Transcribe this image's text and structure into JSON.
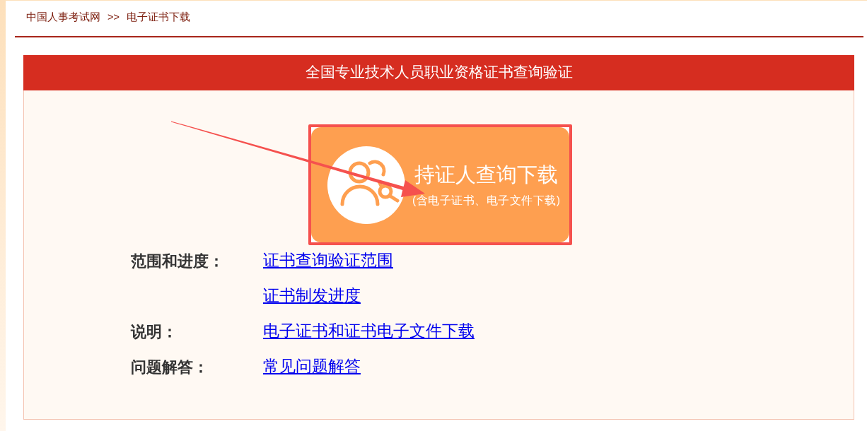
{
  "breadcrumb": {
    "items": [
      "中国人事考试网",
      "电子证书下载"
    ],
    "separator": ">>"
  },
  "panel": {
    "title": "全国专业技术人员职业资格证书查询验证"
  },
  "query_button": {
    "title": "持证人查询下载",
    "subtitle": "(含电子证书、电子文件下载)"
  },
  "info_rows": [
    {
      "label": "范围和进度：",
      "links": [
        "证书查询验证范围",
        "证书制发进度"
      ]
    },
    {
      "label": "说明：",
      "links": [
        "电子证书和证书电子文件下载"
      ]
    },
    {
      "label": "问题解答：",
      "links": [
        "常见问题解答"
      ]
    }
  ]
}
